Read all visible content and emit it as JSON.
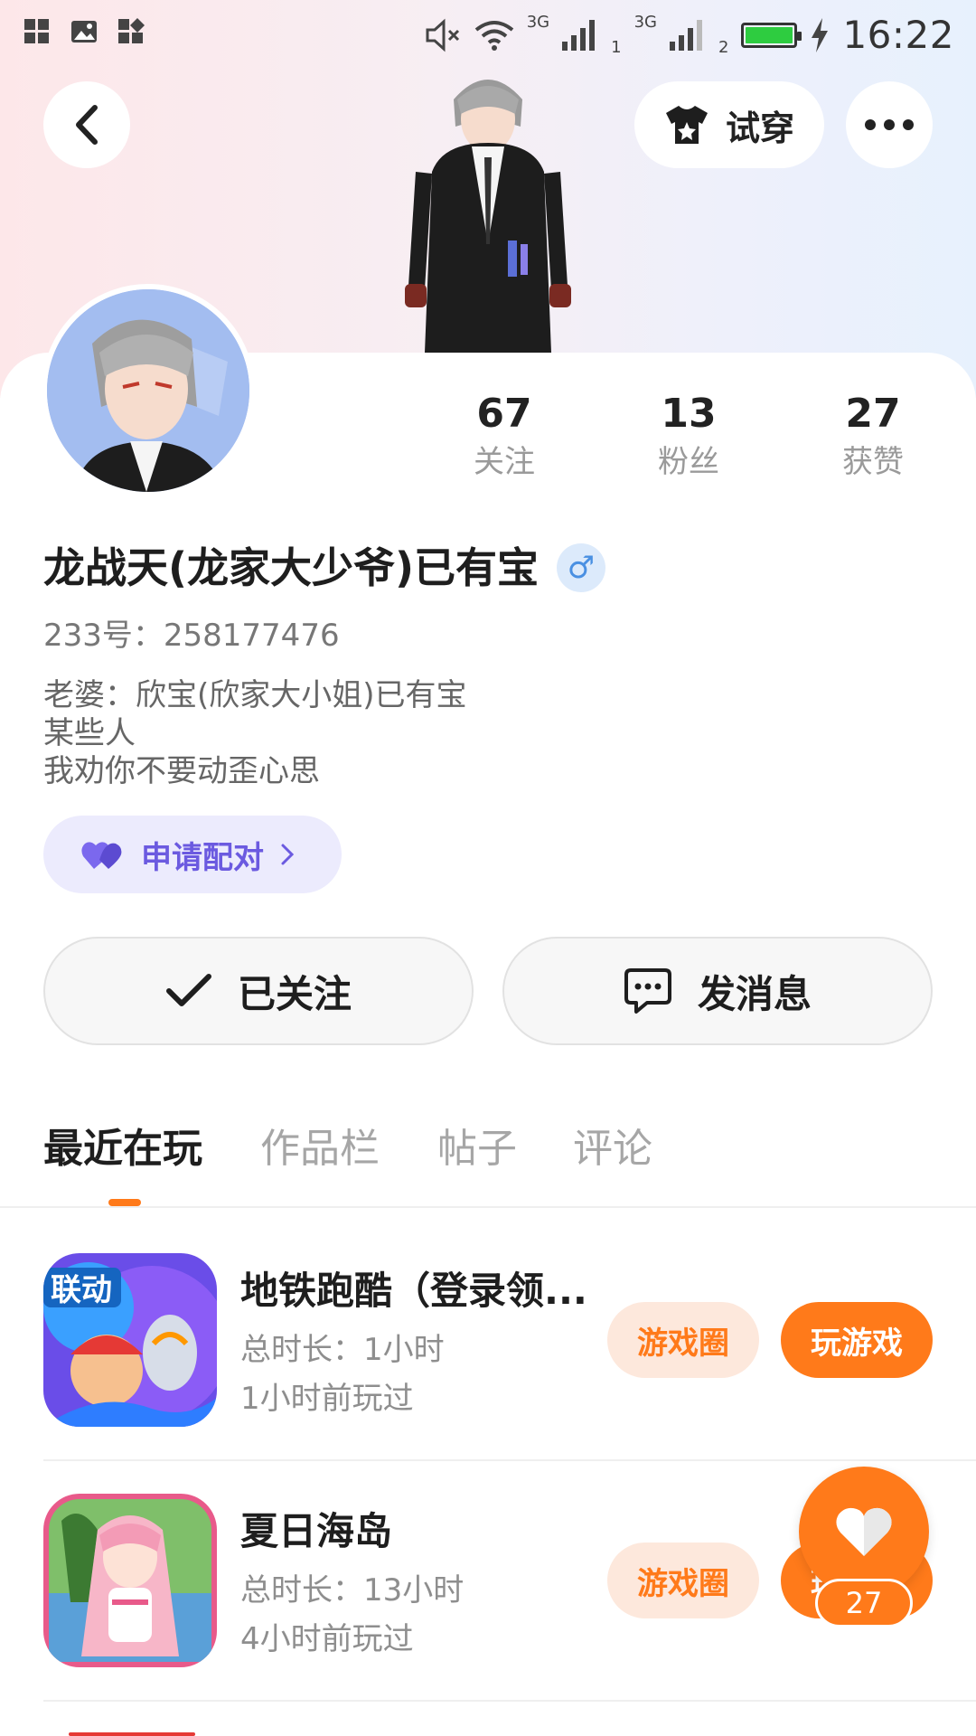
{
  "status_bar": {
    "time": "16:22",
    "network_1": "3G",
    "network_2": "3G",
    "sim_1": "1",
    "sim_2": "2",
    "icons": [
      "app-grid-icon",
      "image-icon",
      "app-grid-icon",
      "mute-icon",
      "wifi-icon",
      "signal-icon",
      "signal-icon",
      "battery-icon",
      "charging-icon"
    ],
    "battery_color": "#2ecc40"
  },
  "header": {
    "back_icon": "chevron-left-icon",
    "tryon_label": "试穿",
    "tryon_icon": "tshirt-icon",
    "more_icon": "more-horizontal-icon"
  },
  "profile": {
    "stats": [
      {
        "value": "67",
        "label": "关注"
      },
      {
        "value": "13",
        "label": "粉丝"
      },
      {
        "value": "27",
        "label": "获赞"
      }
    ],
    "nickname": "龙战天(龙家大少爷)已有宝",
    "gender_symbol": "♂",
    "user_id": "233号：258177476",
    "bio_lines": [
      "老婆：欣宝(欣家大小姐)已有宝",
      "某些人",
      "我劝你不要动歪心思"
    ],
    "pair_label": "申请配对",
    "pair_color": "#6b5ae0"
  },
  "actions": {
    "follow_label": "已关注",
    "message_label": "发消息"
  },
  "tabs": [
    "最近在玩",
    "作品栏",
    "帖子",
    "评论"
  ],
  "accent_color": "#ff7a1a",
  "games": [
    {
      "title": "地铁跑酷（登录领...",
      "duration": "总时长：1小时",
      "last_played": "1小时前玩过",
      "icon_text": "联动",
      "circle_label": "游戏圈",
      "play_label": "玩游戏"
    },
    {
      "title": "夏日海岛",
      "duration": "总时长：13小时",
      "last_played": "4小时前玩过",
      "circle_label": "游戏圈",
      "play_label": "玩游戏"
    }
  ],
  "like_fab": {
    "icon": "heart-icon",
    "count": "27"
  }
}
